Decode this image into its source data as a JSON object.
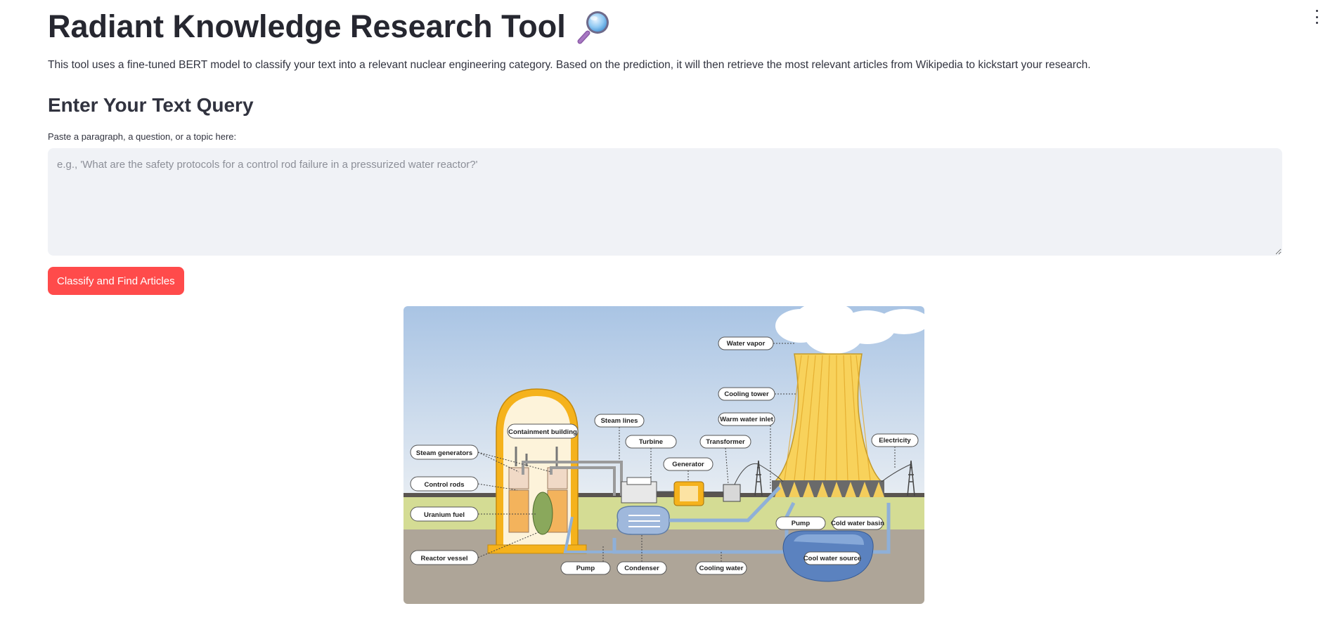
{
  "page": {
    "title": "Radiant Knowledge Research Tool",
    "title_icon": "magnifying-glass-icon",
    "description": "This tool uses a fine-tuned BERT model to classify your text into a relevant nuclear engineering category. Based on the prediction, it will then retrieve the most relevant articles from Wikipedia to kickstart your research.",
    "subheader": "Enter Your Text Query",
    "menu_icon": "vertical-dots-menu-icon"
  },
  "query": {
    "label": "Paste a paragraph, a question, or a topic here:",
    "value": "",
    "placeholder": "e.g., 'What are the safety protocols for a control rod failure in a pressurized water reactor?'"
  },
  "submit": {
    "label": "Classify and Find Articles"
  },
  "diagram": {
    "labels": {
      "water_vapor": "Water vapor",
      "cooling_tower": "Cooling tower",
      "warm_water_inlet": "Warm water inlet",
      "steam_lines": "Steam lines",
      "containment_building": "Containment building",
      "turbine": "Turbine",
      "transformer": "Transformer",
      "electricity": "Electricity",
      "steam_generators": "Steam generators",
      "generator": "Generator",
      "control_rods": "Control rods",
      "uranium_fuel": "Uranium fuel",
      "pump_right": "Pump",
      "cold_water_basin": "Cold water basin",
      "reactor_vessel": "Reactor vessel",
      "cool_water_source": "Cool water source",
      "pump_bottom": "Pump",
      "condenser": "Condenser",
      "cooling_water": "Cooling water"
    },
    "colors": {
      "sky": "#b7cde6",
      "ground": "#aea598",
      "grass": "#d4dc94",
      "containment": "#f5b21c",
      "tower": "#f8d25b",
      "water": "#8fb0d8"
    }
  }
}
